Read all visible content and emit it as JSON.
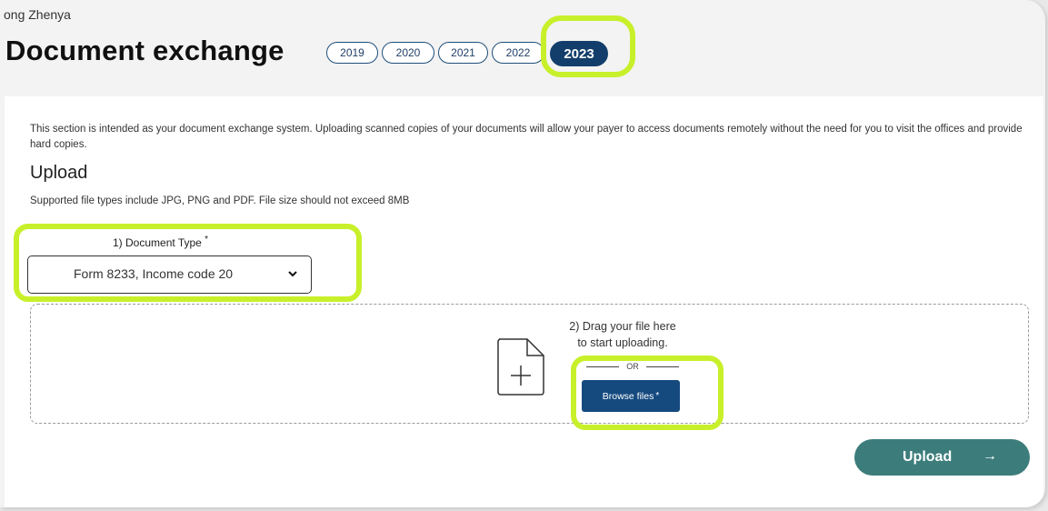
{
  "header": {
    "user_name": "ong Zhenya",
    "title": "Document exchange",
    "years": [
      "2019",
      "2020",
      "2021",
      "2022",
      "2023"
    ],
    "active_year": "2023"
  },
  "content": {
    "intro": "This section is intended as your document exchange system. Uploading scanned copies of your documents will allow your payer to access documents remotely without the need for you to visit the offices and provide hard copies.",
    "upload_heading": "Upload",
    "supported_types": "Supported file types include JPG, PNG and PDF. File size should not exceed 8MB",
    "document_type_label": "1) Document Type",
    "required_marker": "*",
    "document_type_value": "Form 8233, Income code 20",
    "drag_line1": "2) Drag your file here",
    "drag_line2": "to start uploading.",
    "or_label": "OR",
    "browse_label": "Browse files",
    "upload_label": "Upload",
    "upload_arrow": "→"
  },
  "colors": {
    "highlight": "#c8f02a",
    "navy": "#133e6b",
    "teal": "#3c7d7c"
  }
}
